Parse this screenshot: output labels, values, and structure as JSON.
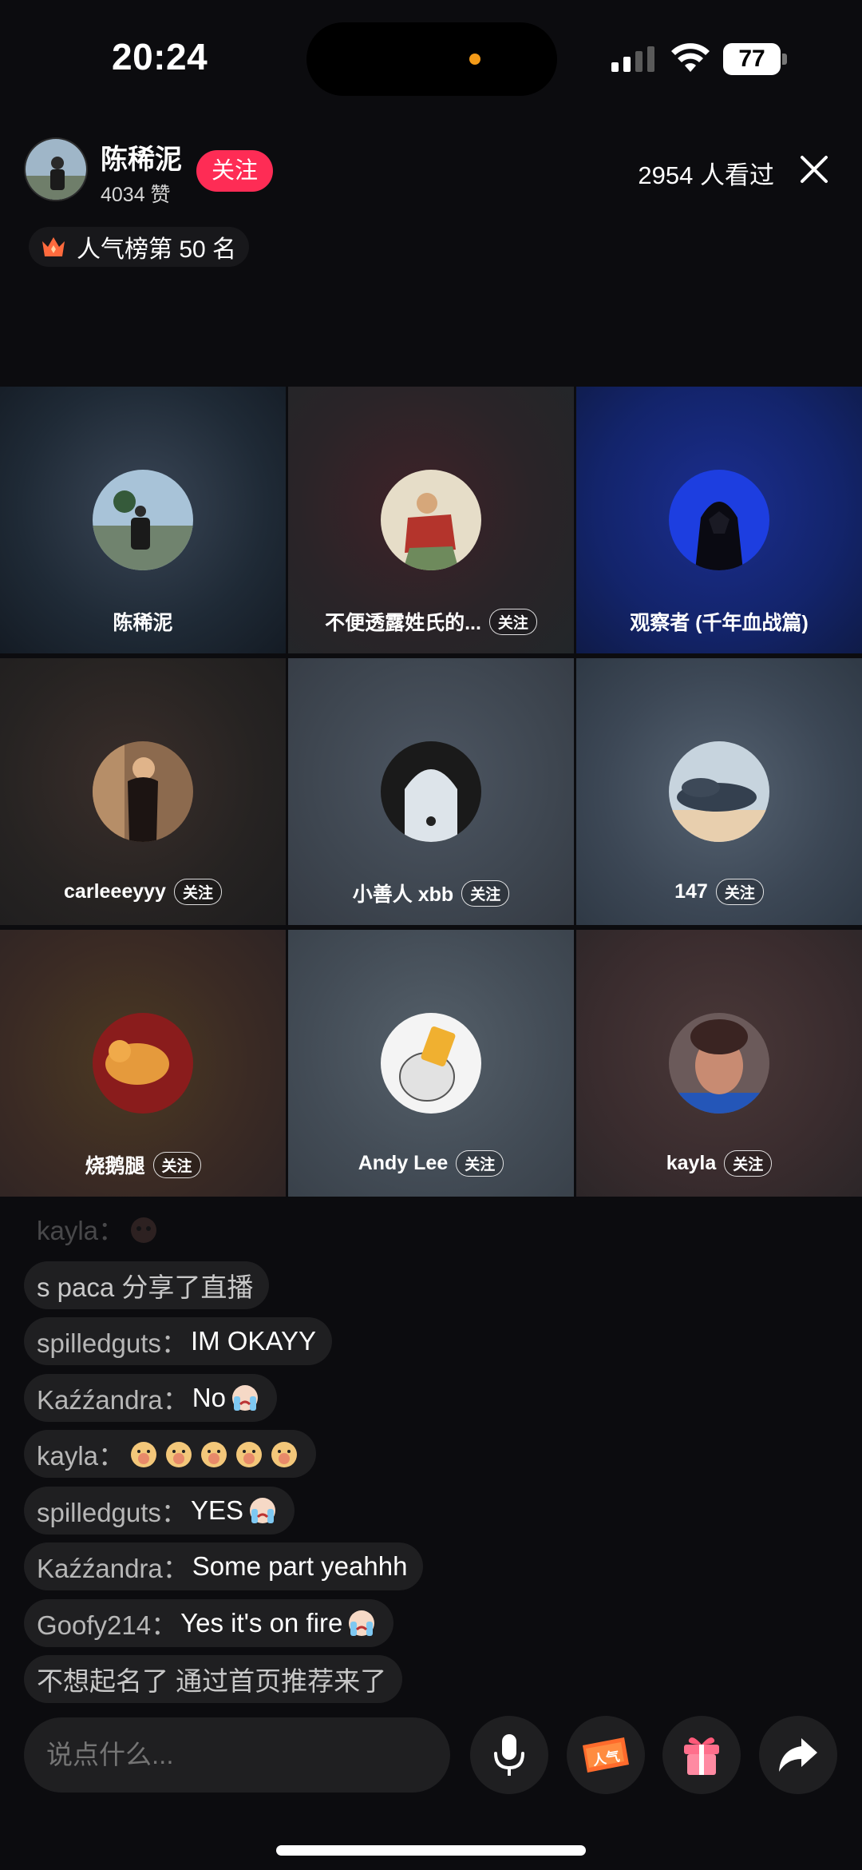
{
  "status_bar": {
    "time": "20:24",
    "battery": "77"
  },
  "host": {
    "name": "陈稀泥",
    "likes": "4034 赞",
    "follow_label": "关注"
  },
  "viewers_text": "2954 人看过",
  "rank_text": "人气榜第 50 名",
  "grid": [
    {
      "name": "陈稀泥",
      "follow": ""
    },
    {
      "name": "不便透露姓氏的...",
      "follow": "关注"
    },
    {
      "name": "观察者 (千年血战篇)",
      "follow": ""
    },
    {
      "name": "carleeeyyy",
      "follow": "关注"
    },
    {
      "name": "小善人 xbb",
      "follow": "关注"
    },
    {
      "name": "147",
      "follow": "关注"
    },
    {
      "name": "烧鹅腿",
      "follow": "关注"
    },
    {
      "name": "Andy Lee",
      "follow": "关注"
    },
    {
      "name": "kayla",
      "follow": "关注"
    }
  ],
  "chat": [
    {
      "user": "kayla：",
      "text": ""
    },
    {
      "system": "s paca 分享了直播"
    },
    {
      "user": "spilledguts：",
      "text": "IM OKAYY"
    },
    {
      "user": "Kaźźandra：",
      "text": "No"
    },
    {
      "user": "kayla：",
      "text": ""
    },
    {
      "user": "spilledguts：",
      "text": "YES"
    },
    {
      "user": "Kaźźandra：",
      "text": "Some part yeahhh"
    },
    {
      "user": "Goofy214：",
      "text": "Yes it's on fire"
    },
    {
      "system": "不想起名了 通过首页推荐来了"
    }
  ],
  "input": {
    "placeholder": "说点什么..."
  },
  "gift_badge": "人气",
  "colors": {
    "accent": "#fe2c55",
    "background": "#0c0c0f"
  },
  "icons": [
    "signal-icon",
    "wifi-icon",
    "battery-icon",
    "close-icon",
    "crown-icon",
    "microphone-icon",
    "popularity-icon",
    "gift-icon",
    "share-icon"
  ]
}
